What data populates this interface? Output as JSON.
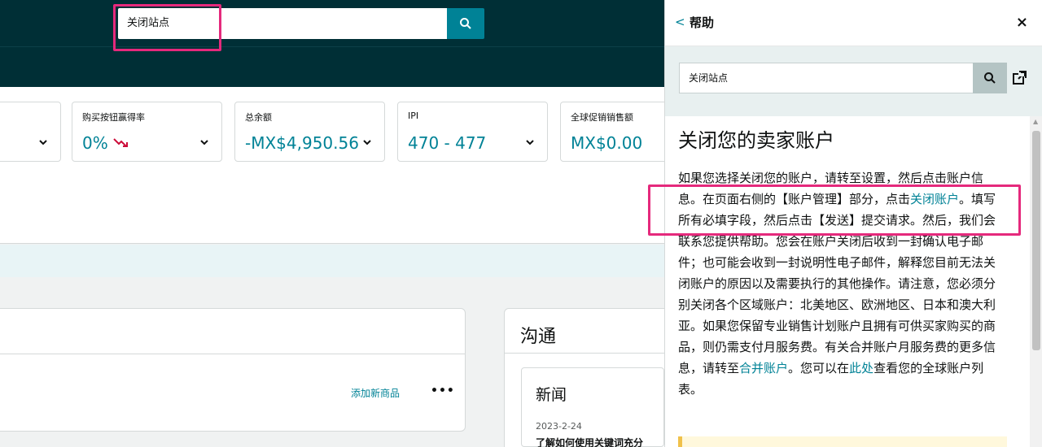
{
  "top_search": {
    "value": "关闭站点"
  },
  "metrics": [
    {
      "title": "",
      "value": ""
    },
    {
      "title": "购买按钮赢得率",
      "value": "0%"
    },
    {
      "title": "总余额",
      "value": "-MX$4,950.56"
    },
    {
      "title": "IPI",
      "value": "470 - 477"
    },
    {
      "title": "全球促销销售额",
      "value": "MX$0.00"
    }
  ],
  "listings_panel": {
    "add_link": "添加新商品",
    "more": "•••"
  },
  "comm_panel": {
    "title": "沟通"
  },
  "news": {
    "title": "新闻",
    "date": "2023-2-24",
    "headline": "了解如何使用关键词充分"
  },
  "help": {
    "back": "<",
    "title": "帮助",
    "close": "×",
    "search_value": "关闭站点",
    "article_title": "关闭您的卖家账户",
    "p1": "如果您选择关闭您的账户，请转至设置，然后点击账户信息。在页面右侧的【账户管理】部分，点击",
    "link_close": "关闭账户",
    "p2": "。填写所有必填字段，然后点击【发送】提交请求。然后，我们会联系您提供帮助。您会在账户关闭后收到一封确认电子邮件；也可能会收到一封说明性电子邮件，解释您目前无法关闭账户的原因以及需要执行的其他操作。请注意，您必须分别关闭各个区域账户：北美地区、欧洲地区、日本和澳大利亚。如果您保留专业销售计划账户且拥有可供买家购买的商品，则仍需支付月服务费。有关合并账户月服务费的更多信息，请转至",
    "link_merge": "合并账户",
    "p3": "。您可以在",
    "link_here": "此处",
    "p4": "查看您的全球账户列表。"
  },
  "colors": {
    "nav": "#002f36",
    "accent": "#008296",
    "highlight": "#e5297c"
  }
}
